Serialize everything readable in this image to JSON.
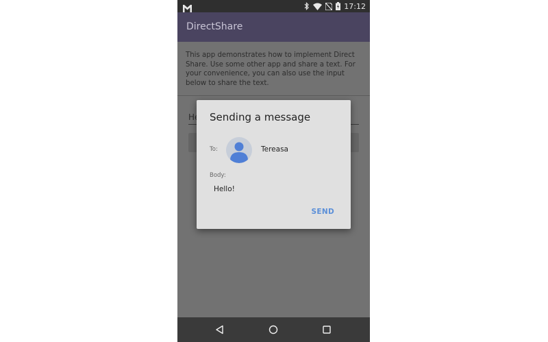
{
  "status_bar": {
    "time": "17:12",
    "icons": [
      "gmail-icon",
      "bluetooth-icon",
      "wifi-icon",
      "no-sim-icon",
      "battery-icon"
    ]
  },
  "app_bar": {
    "title": "DirectShare"
  },
  "main": {
    "description": "This app demonstrates how to implement Direct Share. Use some other app and share a text. For your convenience, you can also use the input below to share the text.",
    "input_value": "He"
  },
  "dialog": {
    "title": "Sending a message",
    "to_label": "To:",
    "recipient": "Tereasa",
    "body_label": "Body:",
    "body_text": "Hello!",
    "send_label": "SEND"
  },
  "nav_bar": {
    "icons": [
      "back-icon",
      "home-icon",
      "recents-icon"
    ]
  },
  "colors": {
    "app_bar": "#4a4460",
    "accent": "#5b8fd8",
    "avatar_bg": "#c7ced9",
    "avatar_figure": "#4f7fd6"
  }
}
